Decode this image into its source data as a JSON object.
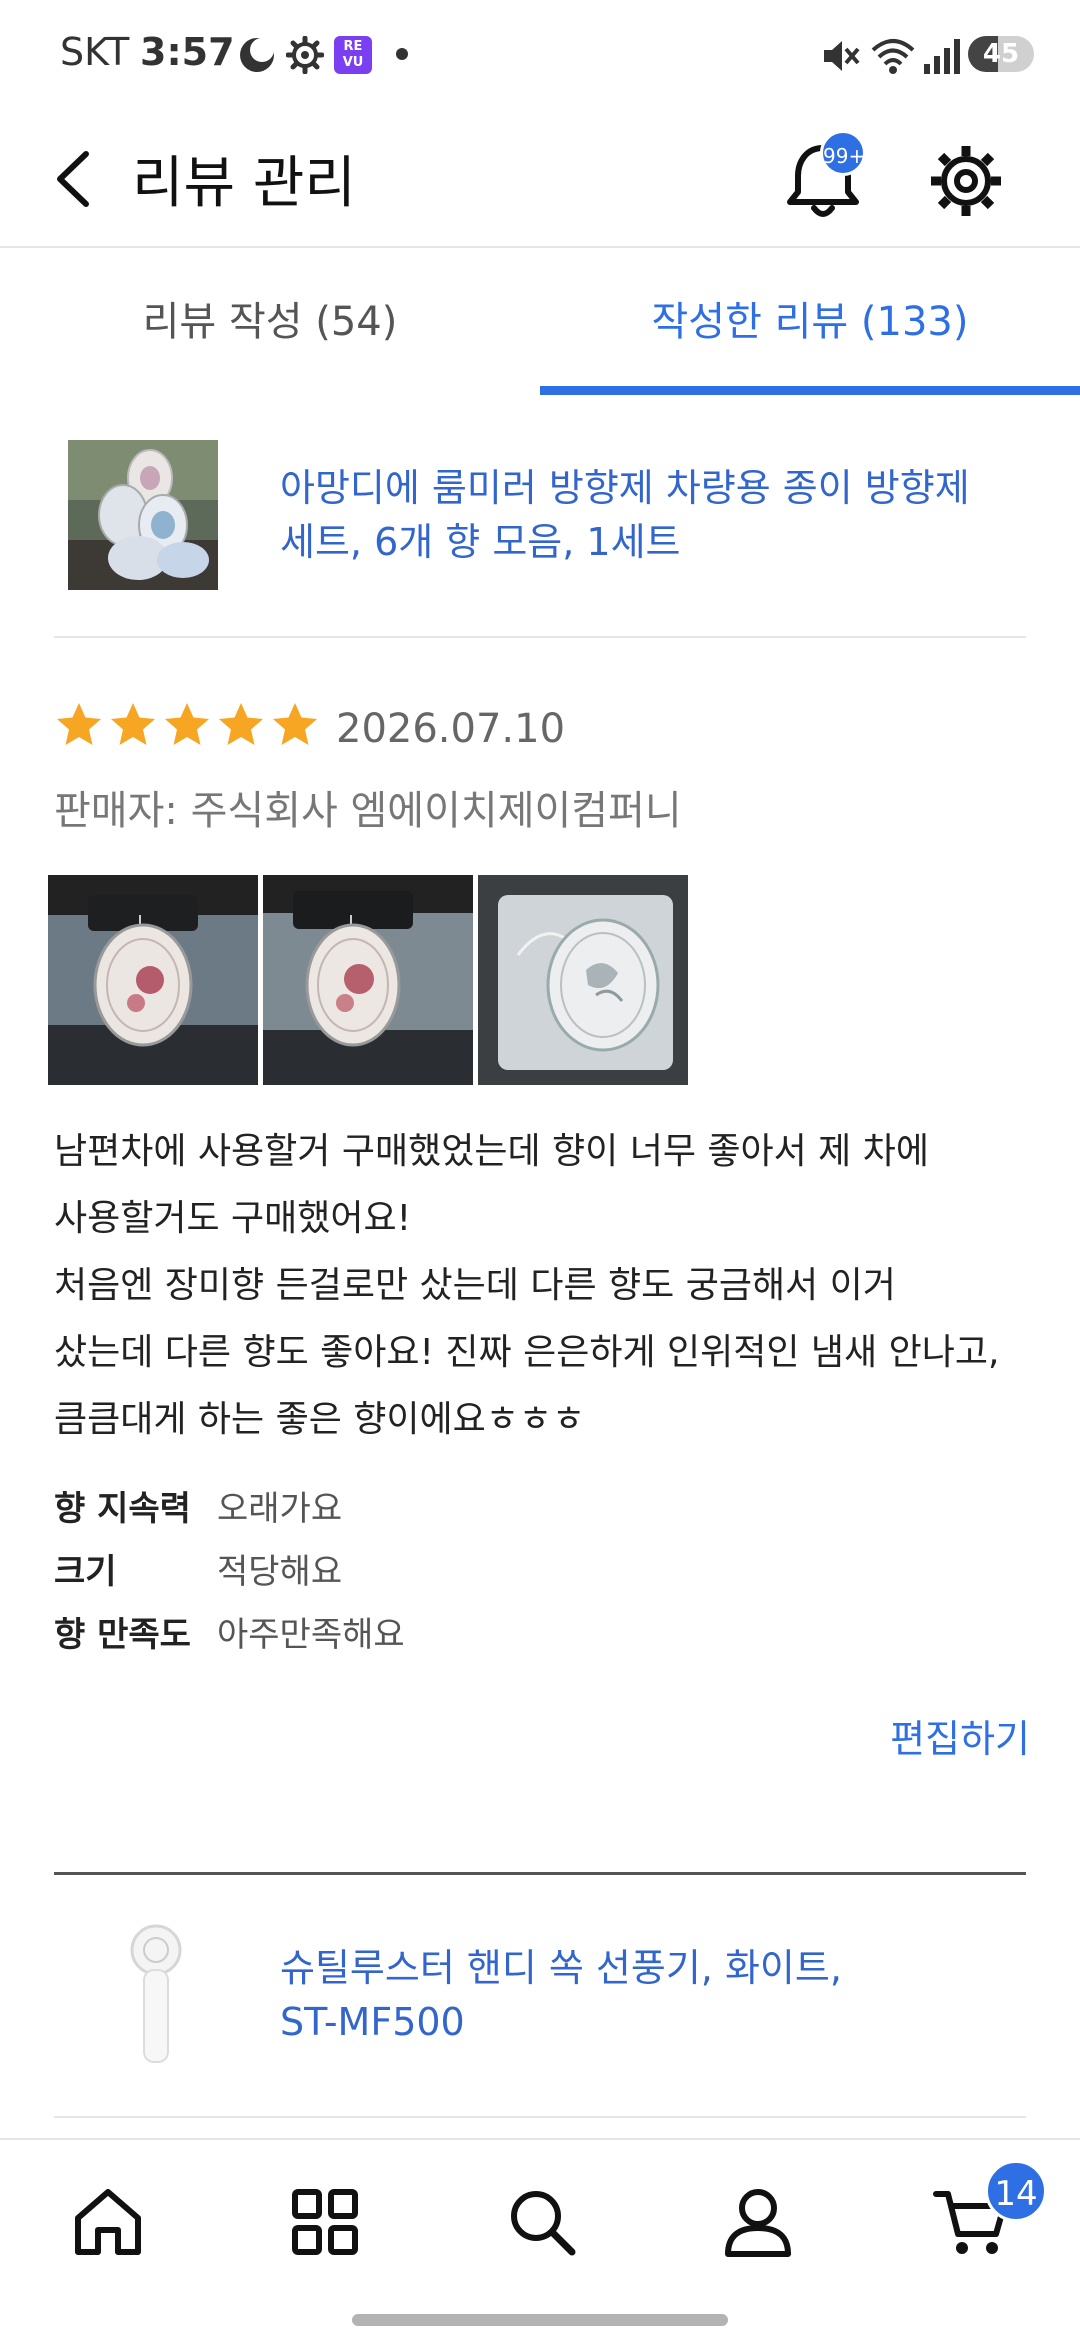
{
  "status_bar": {
    "carrier": "SKT",
    "time": "3:57",
    "revu_badge": "RE VU",
    "battery": "45",
    "battery_level": 0.45,
    "icons": [
      "moon-icon",
      "gear-icon",
      "revu-app-icon",
      "mute-icon",
      "wifi-icon",
      "signal-icon",
      "battery-icon"
    ]
  },
  "header": {
    "title": "리뷰 관리",
    "notification_badge": "99+"
  },
  "tabs": [
    {
      "label": "리뷰 작성 (54)",
      "active": false
    },
    {
      "label": "작성한 리뷰 (133)",
      "active": true
    }
  ],
  "reviews": [
    {
      "product_title_line1": "아망디에 룸미러 방향제 차량용 종이 방향제",
      "product_title_line2": "세트, 6개 향 모음, 1세트",
      "rating": 5,
      "date": "2026.07.10",
      "seller": "판매자: 주식회사 엠에이치제이컴퍼니",
      "text_lines": [
        "남편차에 사용할거 구매했었는데 향이 너무 좋아서 제 차에",
        "사용할거도 구매했어요!",
        "처음엔 장미향 든걸로만 샀는데 다른 향도 궁금해서 이거",
        "샀는데 다른 향도 좋아요! 진짜 은은하게 인위적인 냄새 안나고,",
        "큼큼대게 하는 좋은 향이에요ㅎㅎㅎ"
      ],
      "attributes": [
        {
          "label": "향 지속력",
          "value": "오래가요"
        },
        {
          "label": "크기",
          "value": "적당해요"
        },
        {
          "label": "향 만족도",
          "value": "아주만족해요"
        }
      ],
      "edit_label": "편집하기"
    },
    {
      "product_title_line1": "슈틸루스터 핸디 쏙 선풍기, 화이트,",
      "product_title_line2": "ST-MF500"
    }
  ],
  "bottom_nav": {
    "items": [
      "home-icon",
      "categories-icon",
      "search-icon",
      "profile-icon",
      "cart-icon"
    ],
    "cart_badge": "14"
  },
  "colors": {
    "accent": "#2f6fe4",
    "link": "#3366cc",
    "star": "#f6a623"
  }
}
